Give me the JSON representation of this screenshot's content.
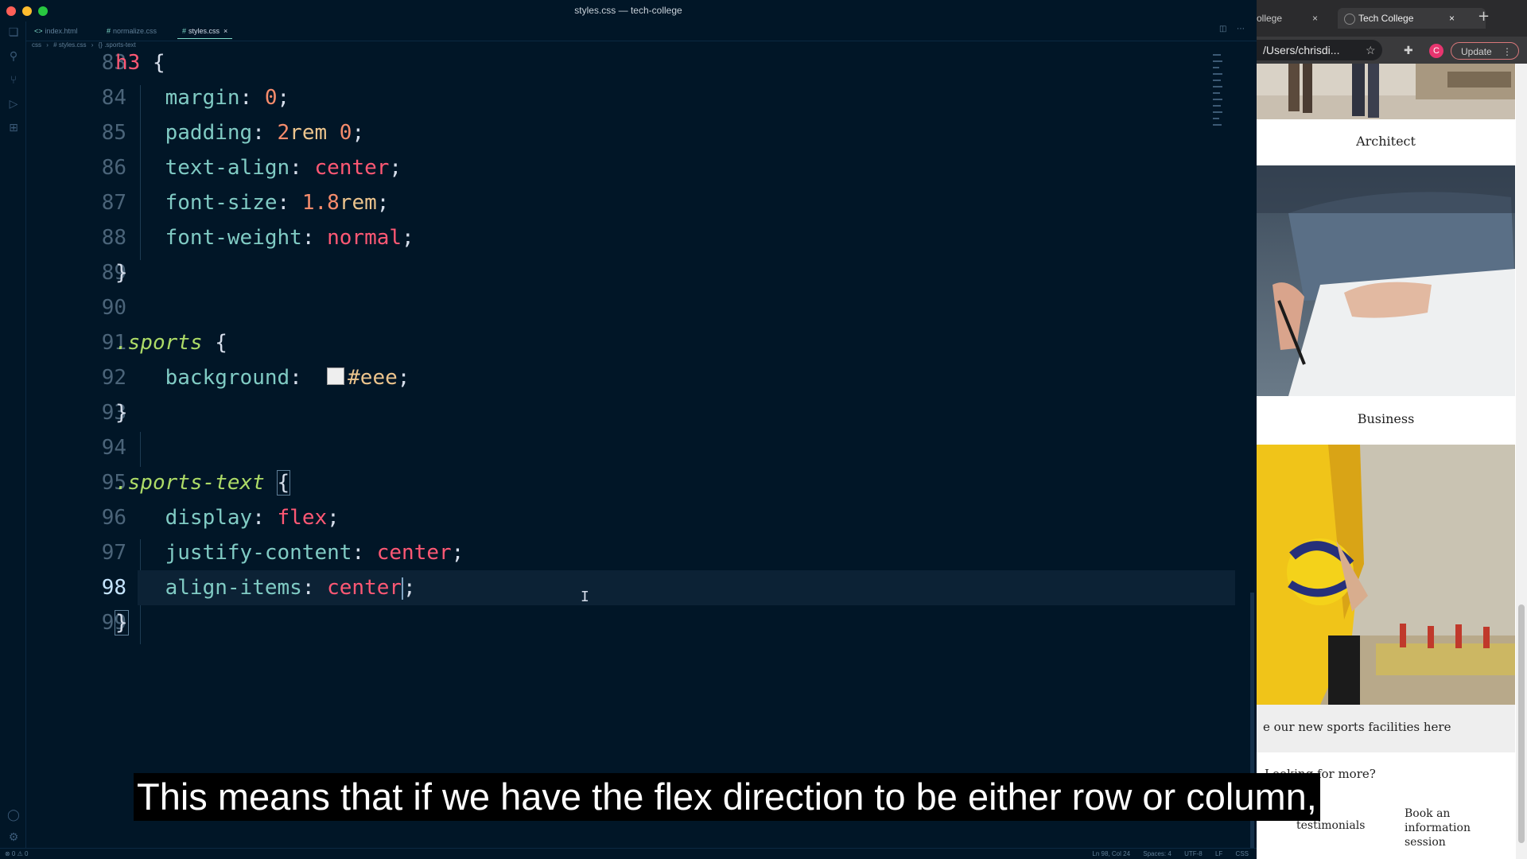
{
  "window": {
    "title": "styles.css — tech-college"
  },
  "editor": {
    "tabs": [
      {
        "marker": "<>",
        "label": "index.html"
      },
      {
        "marker": "#",
        "label": "normalize.css"
      },
      {
        "marker": "#",
        "label": "styles.css",
        "close": "×"
      }
    ],
    "breadcrumb": [
      "css",
      "#  styles.css",
      "{}  .sports-text"
    ],
    "lines": [
      {
        "n": "83"
      },
      {
        "n": "84"
      },
      {
        "n": "85"
      },
      {
        "n": "86"
      },
      {
        "n": "87"
      },
      {
        "n": "88"
      },
      {
        "n": "89"
      },
      {
        "n": "90"
      },
      {
        "n": "91"
      },
      {
        "n": "92"
      },
      {
        "n": "93"
      },
      {
        "n": "94"
      },
      {
        "n": "95"
      },
      {
        "n": "96"
      },
      {
        "n": "97"
      },
      {
        "n": "98"
      },
      {
        "n": "99"
      }
    ],
    "code": {
      "l83": {
        "sel": "h3",
        "brace": " {"
      },
      "l84": {
        "prop": "margin",
        "colon": ": ",
        "v1": "0",
        "end": ";"
      },
      "l85": {
        "prop": "padding",
        "colon": ": ",
        "v1": "2",
        "u1": "rem",
        "sp": " ",
        "v2": "0",
        "end": ";"
      },
      "l86": {
        "prop": "text-align",
        "colon": ": ",
        "kw": "center",
        "end": ";"
      },
      "l87": {
        "prop": "font-size",
        "colon": ": ",
        "v1": "1.8",
        "u1": "rem",
        "end": ";"
      },
      "l88": {
        "prop": "font-weight",
        "colon": ": ",
        "kw": "normal",
        "end": ";"
      },
      "l89": {
        "brace": "}"
      },
      "l91": {
        "sel": ".sports",
        "brace": " {"
      },
      "l92": {
        "prop": "background",
        "colon": ":  ",
        "hex": "#eee",
        "end": ";"
      },
      "l93": {
        "brace": "}"
      },
      "l95": {
        "sel": ".sports-text",
        "brace": "{"
      },
      "l96": {
        "prop": "display",
        "colon": ": ",
        "kw": "flex",
        "end": ";"
      },
      "l97": {
        "prop": "justify-content",
        "colon": ": ",
        "kw": "center",
        "end": ";"
      },
      "l98": {
        "prop": "align-items",
        "colon": ": ",
        "kw": "center",
        "end": ";"
      },
      "l99": {
        "brace": "}"
      }
    },
    "status": {
      "left": "⊗ 0 ⚠ 0",
      "items": [
        "Ln 98, Col 24",
        "Spaces: 4",
        "UTF-8",
        "LF",
        "CSS"
      ]
    }
  },
  "browser": {
    "tabs": [
      {
        "label": "ollege",
        "close": "×"
      },
      {
        "label": "Tech College",
        "close": "×"
      }
    ],
    "new_tab": "+",
    "address": "/Users/chrisdi...",
    "profile_initial": "C",
    "update_label": "Update",
    "page": {
      "captions": [
        "Architect",
        "Business"
      ],
      "sports_text": "e our new sports facilities here",
      "looking_more": "Looking for more?",
      "footer_col_1": "testimonials",
      "footer_col_2": "Book an information session"
    }
  },
  "subtitle": "This means that if we have the flex direction to be either row or column,",
  "colors": {
    "editor_bg": "#011627",
    "selector": "#ff5874",
    "class_selector": "#addb67",
    "property": "#80cbc4",
    "number": "#f78c6c",
    "unit": "#ecc48d",
    "keyword": "#ff5874"
  }
}
